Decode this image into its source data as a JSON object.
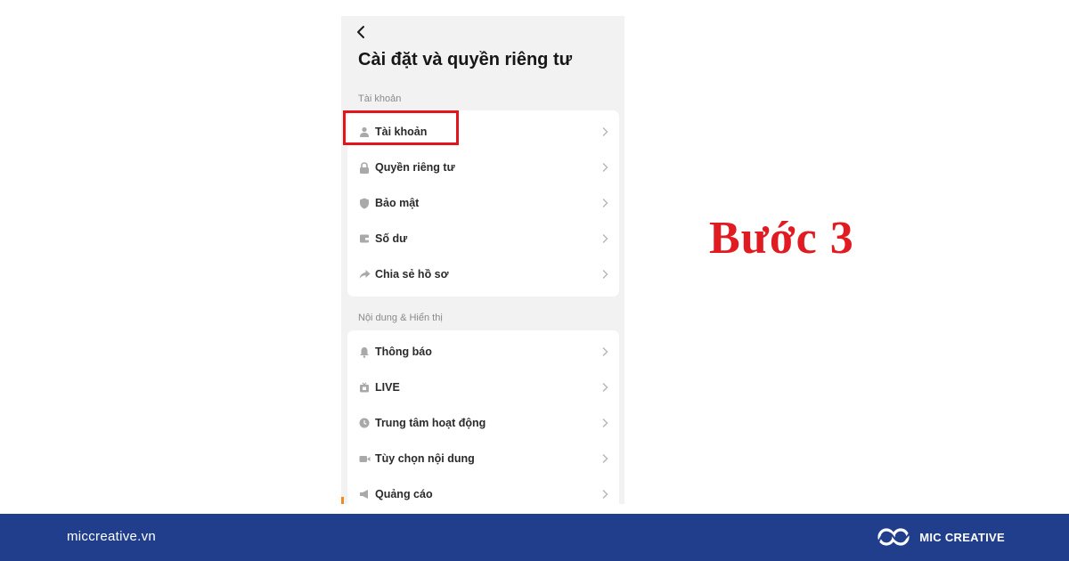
{
  "phone": {
    "title": "Cài đặt và quyền riêng tư",
    "sections": [
      {
        "label": "Tài khoản",
        "items": [
          {
            "label": "Tài khoản",
            "icon": "person-icon"
          },
          {
            "label": "Quyền riêng tư",
            "icon": "lock-icon"
          },
          {
            "label": "Bảo mật",
            "icon": "shield-icon"
          },
          {
            "label": "Số dư",
            "icon": "wallet-icon"
          },
          {
            "label": "Chia sẻ hồ sơ",
            "icon": "share-arrow-icon"
          }
        ]
      },
      {
        "label": "Nội dung & Hiển thị",
        "items": [
          {
            "label": "Thông báo",
            "icon": "bell-icon"
          },
          {
            "label": "LIVE",
            "icon": "live-tv-icon"
          },
          {
            "label": "Trung tâm hoạt động",
            "icon": "clock-icon"
          },
          {
            "label": "Tùy chọn nội dung",
            "icon": "video-camera-icon"
          },
          {
            "label": "Quảng cáo",
            "icon": "megaphone-icon"
          }
        ]
      }
    ]
  },
  "step_title": "Bước 3",
  "footer": {
    "site": "miccreative.vn",
    "brand": "MIC CREATIVE"
  },
  "colors": {
    "highlight": "#e3141c",
    "step_text": "#e01b22",
    "footer_bg": "#213e8c",
    "icon_gray": "#a9a9a9"
  }
}
